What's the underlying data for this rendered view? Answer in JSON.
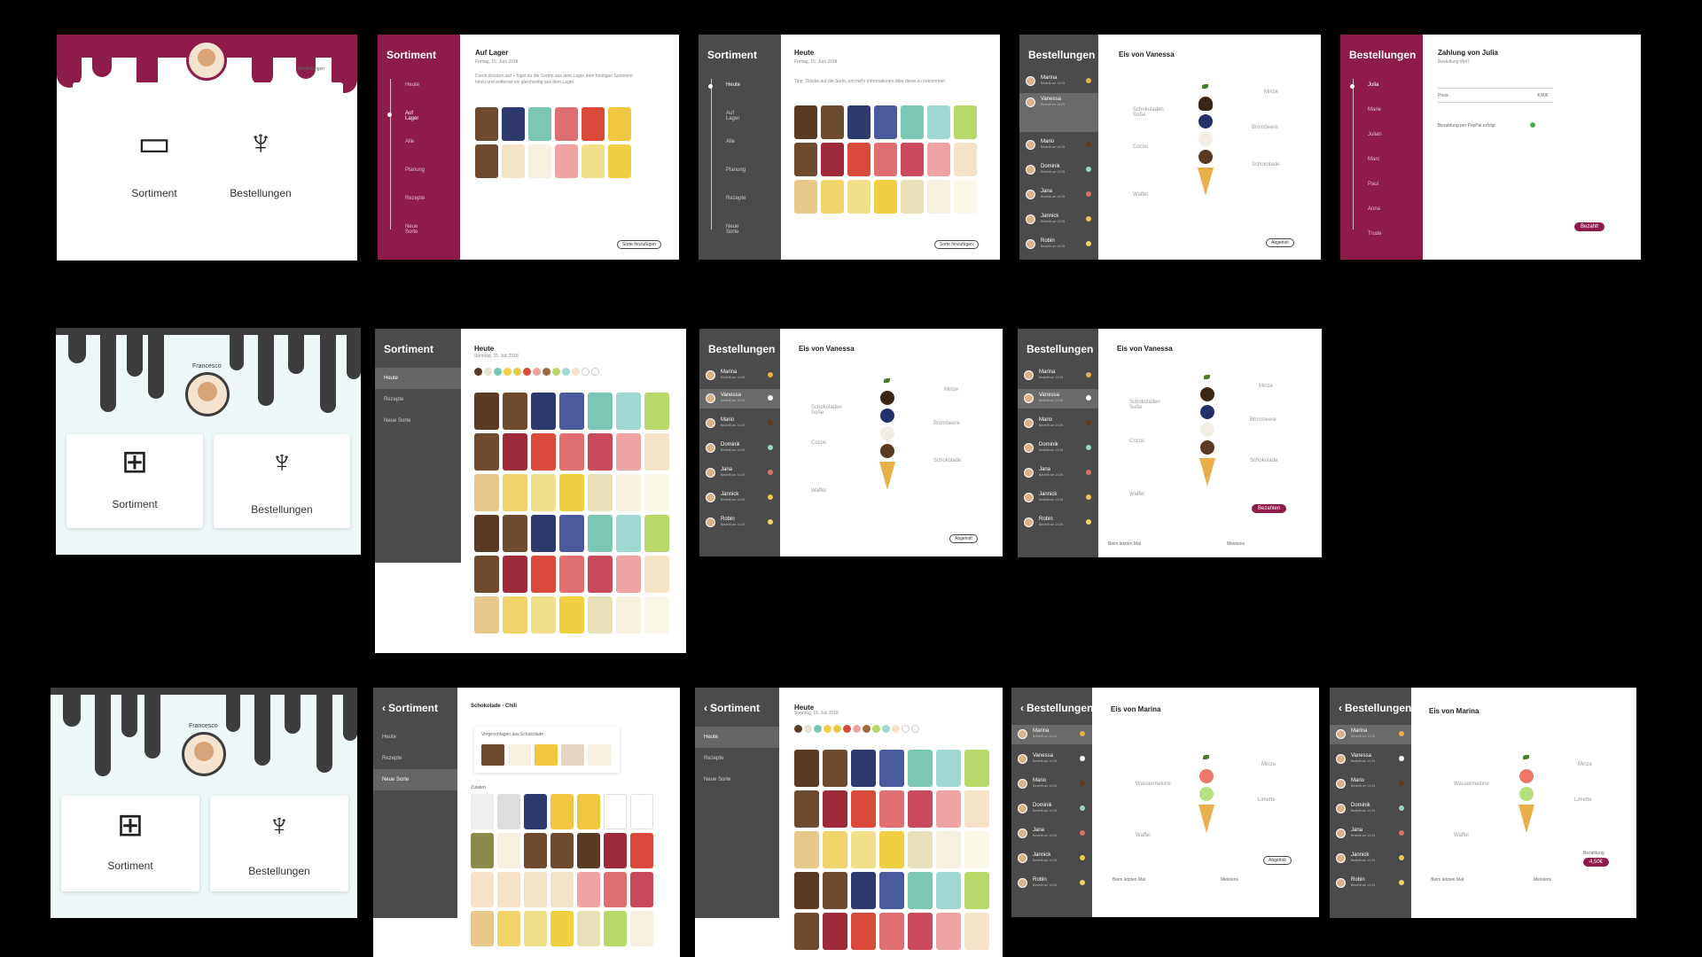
{
  "colors": {
    "brand_red": "#8e1c4a",
    "dark": "#3d3d3d",
    "sidebar_dark": "#4b4b4b"
  },
  "screen_home_red": {
    "settings": "Einstellungen",
    "tile1": "Sortiment",
    "tile2": "Bestellungen",
    "icon1": "ice-display-icon",
    "icon2": "ice-cone-icon"
  },
  "screen_auflager": {
    "side_title": "Sortiment",
    "timeline": [
      "Heute",
      "Auf Lager",
      "Alle",
      "Planung",
      "Rezepte",
      "Neue Sorte"
    ],
    "title": "Auf Lager",
    "date": "Freitag, 15. Juni 2018",
    "hint": "Durch drücken auf + fügst du die Sorten aus dem Lager dem heutigen Sortiment hinzu und entfernst sie gleichzeitig aus dem Lager.",
    "button": "Sorte hinzufügen"
  },
  "screen_heute_dark": {
    "side_title": "Sortiment",
    "timeline": [
      "Heute",
      "Auf Lager",
      "Alle",
      "Planung",
      "Rezepte",
      "Neue Sorte"
    ],
    "title": "Heute",
    "date": "Freitag, 15. Juni 2018",
    "hint": "Tipp: Drücke auf die Sorte, um mehr Informationen über diese zu bekommen",
    "button": "Sorte hinzufügen"
  },
  "orders": [
    {
      "name": "Marina",
      "color": "#e8b04a"
    },
    {
      "name": "Vanessa",
      "color": "#ffffff"
    },
    {
      "name": "Mario",
      "color": "#5a3a22"
    },
    {
      "name": "Dominik",
      "color": "#9bd4c0"
    },
    {
      "name": "Jana",
      "color": "#e07070"
    },
    {
      "name": "Jannick",
      "color": "#e8c94a"
    },
    {
      "name": "Robin",
      "color": "#f0d46a"
    }
  ],
  "order_sub": "Bestellt um 14:25",
  "screen_order_vanessa": {
    "side_title": "Bestellungen",
    "title": "Eis von Vanessa",
    "labels": [
      "Schokoladen Soße",
      "Minze",
      "Brombeere",
      "Cocos",
      "Schokolade",
      "Waffel"
    ],
    "button": "Abgeholt"
  },
  "screen_payment": {
    "side_title": "Bestellungen",
    "timeline": [
      "Julia",
      "Marie",
      "Julian",
      "Marc",
      "Paul",
      "Anna",
      "Trude"
    ],
    "title": "Zahlung von Julia",
    "order_no": "Bestellung #547",
    "price_label": "Preis:",
    "price": "4,90€",
    "paypal": "Bezahlung per PayPal erfolgt",
    "button": "Bezahlt"
  },
  "screen_home_dark": {
    "name": "Francesco",
    "tile1": "Sortiment",
    "tile2": "Bestellungen",
    "icon1": "grid-icon",
    "icon2": "ice-cone-icon"
  },
  "screen_heute_list": {
    "side_title": "Sortiment",
    "menu": [
      "Heute",
      "Rezepte",
      "Neue Sorte"
    ],
    "title": "Heute",
    "date": "Sonntag, 15. Juli 2018"
  },
  "screen_order_vanessa2": {
    "side_title": "Bestellungen",
    "title": "Eis von Vanessa",
    "labels": [
      "Schokoladen Soße",
      "Minze",
      "Brombeere",
      "Cocos",
      "Schokolade",
      "Waffel"
    ],
    "button": "Abgeholt"
  },
  "screen_order_vanessa3": {
    "side_title": "Bestellungen",
    "title": "Eis von Vanessa",
    "labels": [
      "Schokoladen Soße",
      "Minze",
      "Brombeere",
      "Cocos",
      "Schokolade",
      "Waffel"
    ],
    "button": "Bezahlen",
    "last_label": "Beim letzten Mal",
    "most_label": "Meistens"
  },
  "screen_home_dark2": {
    "name": "Francesco",
    "tile1": "Sortiment",
    "tile2": "Bestellungen",
    "icon1": "grid-icon",
    "icon2": "ice-cone-icon"
  },
  "screen_neue_sorte": {
    "side_title": "Sortiment",
    "menu": [
      "Heute",
      "Rezepte",
      "Neue Sorte"
    ],
    "title": "Schokolade - Chili",
    "suggest": "Vorgeschlagen aus Schokolade",
    "ingredients": "Zutaten"
  },
  "screen_heute_list2": {
    "side_title": "Sortiment",
    "menu": [
      "Heute",
      "Rezepte",
      "Neue Sorte"
    ],
    "title": "Heute",
    "date": "Sonntag, 15. Juli 2018"
  },
  "screen_order_marina": {
    "side_title": "Bestellungen",
    "title": "Eis von Marina",
    "labels": [
      "Minze",
      "Wassermelone",
      "Limette",
      "Waffel"
    ],
    "button": "Abgeholt",
    "last_label": "Beim letzten Mal",
    "most_label": "Meistens"
  },
  "screen_order_marina2": {
    "side_title": "Bestellungen",
    "title": "Eis von Marina",
    "labels": [
      "Minze",
      "Wassermelone",
      "Limette",
      "Waffel"
    ],
    "pay_label": "Bezahlung",
    "price": "4,50€",
    "last_label": "Beim letzten Mal",
    "most_label": "Meistens"
  },
  "tile_rows": [
    [
      "#5a3a22",
      "#6e4a2e",
      "#2e3a6e",
      "#4a5a9e",
      "#7ac7b3",
      "#9fd8d0",
      "#b8d86a"
    ],
    [
      "#6e4a2e",
      "#9e2a3a",
      "#d94a3a",
      "#e07070",
      "#c94a5a",
      "#f0a3a3",
      "#f5e3c8"
    ],
    [
      "#e8c98a",
      "#f0d46a",
      "#f0e08a",
      "#f0d040",
      "#e8e0b8",
      "#f5f0e0",
      "#faf6e8"
    ]
  ]
}
